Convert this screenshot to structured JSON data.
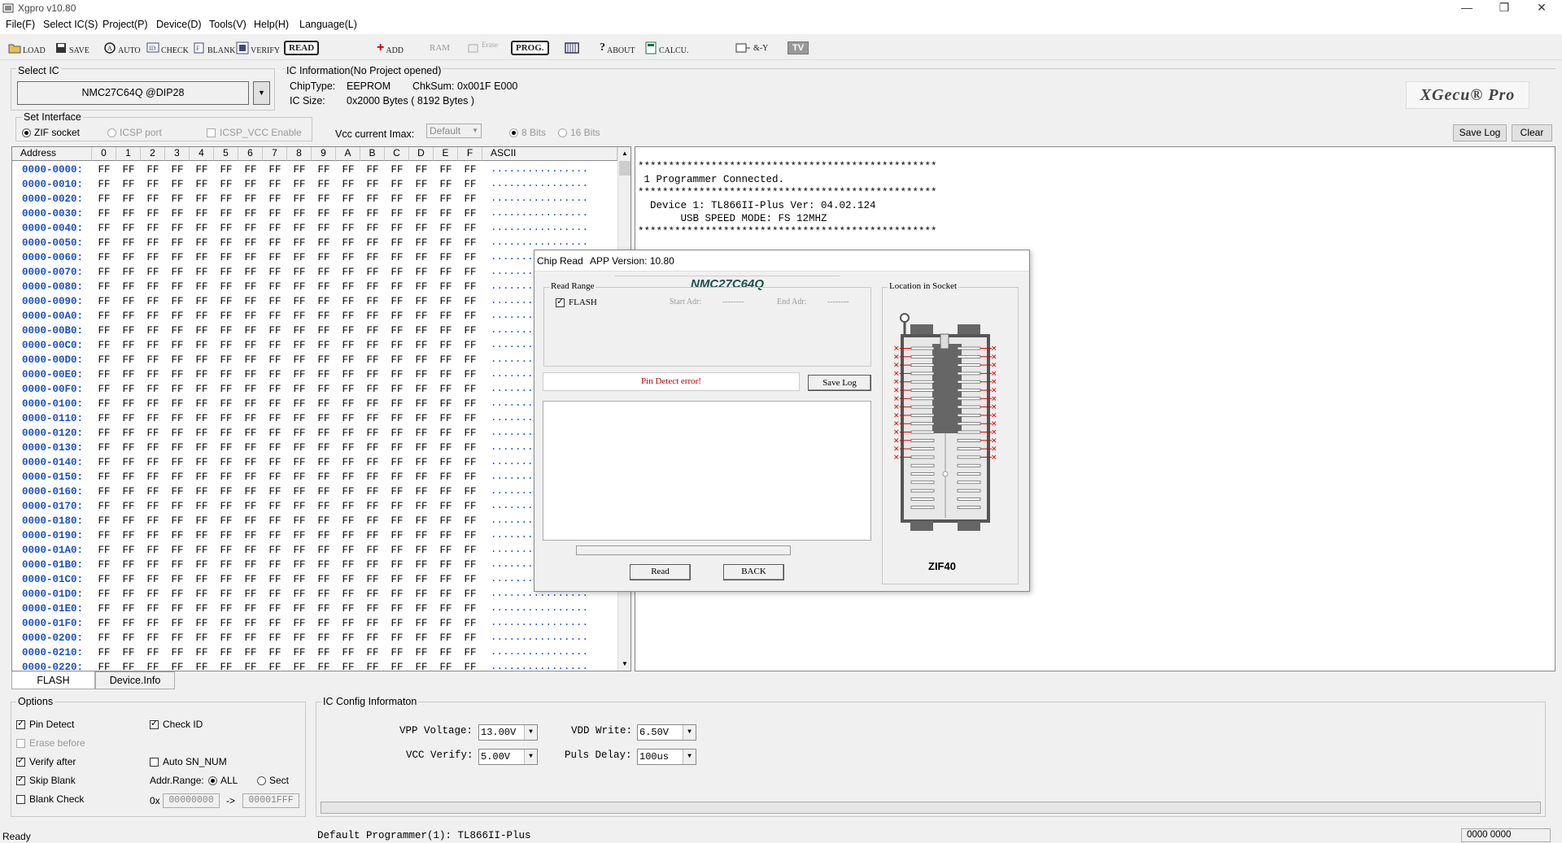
{
  "window": {
    "title": "Xgpro v10.80"
  },
  "menu": [
    "File(F)",
    "Select IC(S)",
    "Project(P)",
    "Device(D)",
    "Tools(V)",
    "Help(H)",
    "Language(L)"
  ],
  "toolbar": {
    "load": "LOAD",
    "save": "SAVE",
    "auto": "AUTO",
    "check": "CHECK",
    "blank": "BLANK",
    "verify": "VERIFY",
    "read": "READ",
    "add": "ADD",
    "ram": "RAM",
    "erase": "Erase",
    "prog": "PROG.",
    "about": "ABOUT",
    "calcu": "CALCU.",
    "logic": "&-Y",
    "tv": "TV"
  },
  "select_ic": {
    "label": "Select IC",
    "value": "NMC27C64Q @DIP28"
  },
  "ic_info": {
    "label": "IC Information(No Project opened)",
    "chiptype_label": "ChipType:",
    "chiptype_value": "EEPROM",
    "chksum_label": "ChkSum:",
    "chksum_value": "0x001F E000",
    "size_label": "IC Size:",
    "size_value": "0x2000 Bytes ( 8192 Bytes )"
  },
  "brand": {
    "logo_text": "XGecu® Pro"
  },
  "interface": {
    "label": "Set Interface",
    "zif": "ZIF socket",
    "icsp": "ICSP port",
    "icsp_vcc": "ICSP_VCC Enable",
    "vcc_label": "Vcc current Imax:",
    "vcc_value": "Default",
    "bits8": "8 Bits",
    "bits16": "16 Bits"
  },
  "log_buttons": {
    "save_log": "Save Log",
    "clear": "Clear"
  },
  "hex": {
    "headers": [
      "Address",
      "0",
      "1",
      "2",
      "3",
      "4",
      "5",
      "6",
      "7",
      "8",
      "9",
      "A",
      "B",
      "C",
      "D",
      "E",
      "F",
      "ASCII"
    ],
    "addresses": [
      "0000-0000:",
      "0000-0010:",
      "0000-0020:",
      "0000-0030:",
      "0000-0040:",
      "0000-0050:",
      "0000-0060:",
      "0000-0070:",
      "0000-0080:",
      "0000-0090:",
      "0000-00A0:",
      "0000-00B0:",
      "0000-00C0:",
      "0000-00D0:",
      "0000-00E0:",
      "0000-00F0:",
      "0000-0100:",
      "0000-0110:",
      "0000-0120:",
      "0000-0130:",
      "0000-0140:",
      "0000-0150:",
      "0000-0160:",
      "0000-0170:",
      "0000-0180:",
      "0000-0190:",
      "0000-01A0:",
      "0000-01B0:",
      "0000-01C0:",
      "0000-01D0:",
      "0000-01E0:",
      "0000-01F0:",
      "0000-0200:",
      "0000-0210:",
      "0000-0220:"
    ],
    "byte_value": "FF",
    "ascii_value": "................"
  },
  "log": {
    "lines": [
      "*************************************************",
      " 1 Programmer Connected.",
      "*************************************************",
      "  Device 1: TL866II-Plus Ver: 04.02.124",
      "       USB SPEED MODE: FS 12MHZ",
      "*************************************************"
    ]
  },
  "tabs": [
    "FLASH",
    "Device.Info"
  ],
  "options": {
    "label": "Options",
    "pin_detect": "Pin Detect",
    "check_id": "Check ID",
    "erase_before": "Erase before",
    "verify_after": "Verify after",
    "auto_sn": "Auto SN_NUM",
    "skip_blank": "Skip Blank",
    "addr_range": "Addr.Range:",
    "all": "ALL",
    "sect": "Sect",
    "blank_check": "Blank Check",
    "from_prefix": "0x",
    "from_value": "00000000",
    "arrow": "->",
    "to_value": "00001FFF"
  },
  "ic_config": {
    "label": "IC Config Informaton",
    "vpp_label": "VPP Voltage:",
    "vpp_value": "13.00V",
    "vcc_label": "VCC Verify:",
    "vcc_value": "5.00V",
    "vdd_label": "VDD Write:",
    "vdd_value": "6.50V",
    "puls_label": "Puls Delay:",
    "puls_value": "100us"
  },
  "status": {
    "left": "Ready",
    "programmer": "Default Programmer(1): TL866II-Plus",
    "right": "0000 0000"
  },
  "dialog": {
    "title": "Chip Read",
    "app_version": "APP Version: 10.80",
    "chip_name": "NMC27C64Q",
    "read_range_label": "Read Range",
    "flash_label": "FLASH",
    "start_adr_label": "Start Adr:",
    "start_adr_value": "--------",
    "end_adr_label": "End Adr:",
    "end_adr_value": "--------",
    "status_msg": "Pin Detect error!",
    "save_log": "Save Log",
    "read_button": "Read",
    "back_button": "BACK",
    "location_label": "Location in Socket",
    "socket_name": "ZIF40"
  }
}
